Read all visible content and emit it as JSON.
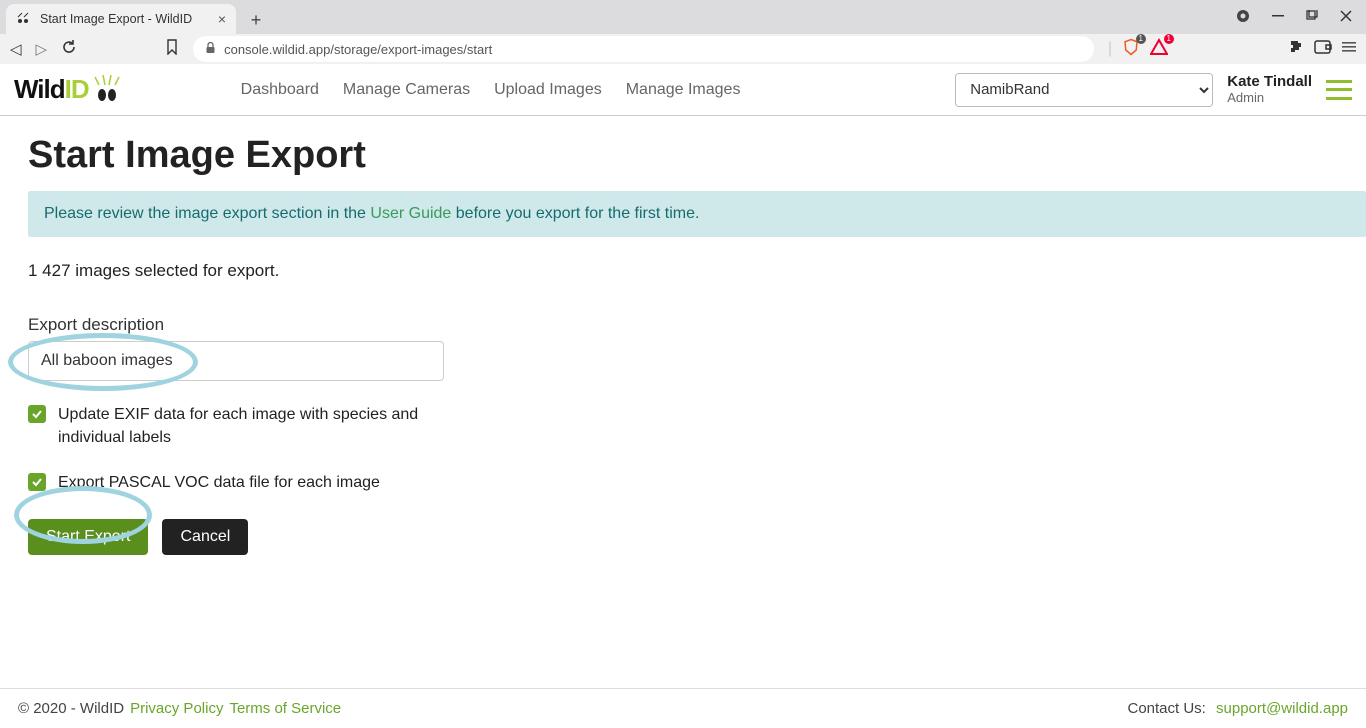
{
  "browser": {
    "tab_title": "Start Image Export - WildID",
    "url": "console.wildid.app/storage/export-images/start",
    "shield_badge": "1",
    "triangle_badge": "1"
  },
  "header": {
    "logo_left": "Wild",
    "logo_right": "ID",
    "nav": {
      "dashboard": "Dashboard",
      "manage_cameras": "Manage Cameras",
      "upload_images": "Upload Images",
      "manage_images": "Manage Images"
    },
    "org_selected": "NamibRand",
    "user_name": "Kate Tindall",
    "user_role": "Admin"
  },
  "page": {
    "title": "Start Image Export",
    "banner_pre": "Please review the image export section in the ",
    "banner_link": "User Guide",
    "banner_post": " before you export for the first time.",
    "count_text": "1 427 images selected for export.",
    "desc_label": "Export description",
    "desc_value": "All baboon images",
    "chk1": "Update EXIF data for each image with species and individual labels",
    "chk2": "Export PASCAL VOC data file for each image",
    "start_btn": "Start Export",
    "cancel_btn": "Cancel"
  },
  "footer": {
    "copyright": "© 2020 - WildID",
    "privacy": "Privacy Policy",
    "terms": "Terms of Service",
    "contact_label": "Contact Us:",
    "contact_email": "support@wildid.app"
  }
}
